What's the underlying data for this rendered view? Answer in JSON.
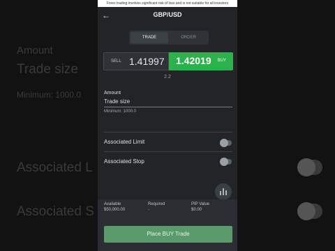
{
  "warning": "Forex trading involves significant risk of loss and is not suitable for all investors",
  "header": {
    "title": "GBP/USD"
  },
  "tabs": [
    {
      "label": "TRADE"
    },
    {
      "label": "ORDER"
    }
  ],
  "prices": {
    "sell_label": "SELL",
    "sell_price": "1.41997",
    "buy_price": "1.42019",
    "buy_label": "BUY",
    "spread": "2.2"
  },
  "amount": {
    "label": "Amount",
    "placeholder": "Trade size",
    "minimum": "Minimum: 1000.0"
  },
  "options": [
    {
      "label": "Associated Limit",
      "enabled": false
    },
    {
      "label": "Associated Stop",
      "enabled": false
    }
  ],
  "stats": [
    {
      "label": "Available",
      "value": "$50,000.00"
    },
    {
      "label": "Required",
      "value": "-"
    },
    {
      "label": "PIP Value",
      "value": "$0.00"
    }
  ],
  "action": {
    "place_label": "Place BUY Trade"
  },
  "background": {
    "amount_label": "Amount",
    "trade_size": "Trade size",
    "minimum": "Minimum: 1000.0",
    "limit": "Associated L",
    "stop": "Associated S"
  },
  "colors": {
    "buy": "#2bb24c",
    "place_button": "#5a9a6b",
    "screen_bg": "#222528"
  }
}
